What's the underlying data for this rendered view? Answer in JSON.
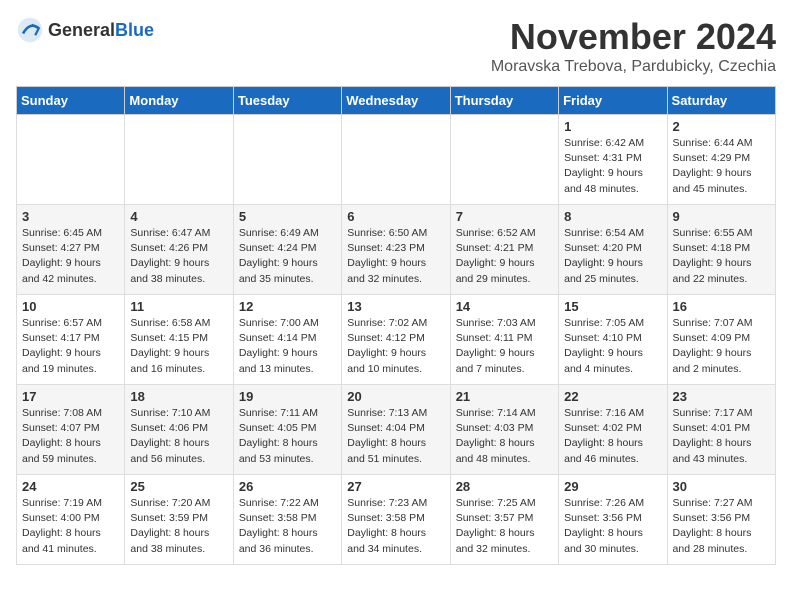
{
  "header": {
    "logo_general": "General",
    "logo_blue": "Blue",
    "month": "November 2024",
    "location": "Moravska Trebova, Pardubicky, Czechia"
  },
  "days_of_week": [
    "Sunday",
    "Monday",
    "Tuesday",
    "Wednesday",
    "Thursday",
    "Friday",
    "Saturday"
  ],
  "weeks": [
    [
      {
        "num": "",
        "info": ""
      },
      {
        "num": "",
        "info": ""
      },
      {
        "num": "",
        "info": ""
      },
      {
        "num": "",
        "info": ""
      },
      {
        "num": "",
        "info": ""
      },
      {
        "num": "1",
        "info": "Sunrise: 6:42 AM\nSunset: 4:31 PM\nDaylight: 9 hours and 48 minutes."
      },
      {
        "num": "2",
        "info": "Sunrise: 6:44 AM\nSunset: 4:29 PM\nDaylight: 9 hours and 45 minutes."
      }
    ],
    [
      {
        "num": "3",
        "info": "Sunrise: 6:45 AM\nSunset: 4:27 PM\nDaylight: 9 hours and 42 minutes."
      },
      {
        "num": "4",
        "info": "Sunrise: 6:47 AM\nSunset: 4:26 PM\nDaylight: 9 hours and 38 minutes."
      },
      {
        "num": "5",
        "info": "Sunrise: 6:49 AM\nSunset: 4:24 PM\nDaylight: 9 hours and 35 minutes."
      },
      {
        "num": "6",
        "info": "Sunrise: 6:50 AM\nSunset: 4:23 PM\nDaylight: 9 hours and 32 minutes."
      },
      {
        "num": "7",
        "info": "Sunrise: 6:52 AM\nSunset: 4:21 PM\nDaylight: 9 hours and 29 minutes."
      },
      {
        "num": "8",
        "info": "Sunrise: 6:54 AM\nSunset: 4:20 PM\nDaylight: 9 hours and 25 minutes."
      },
      {
        "num": "9",
        "info": "Sunrise: 6:55 AM\nSunset: 4:18 PM\nDaylight: 9 hours and 22 minutes."
      }
    ],
    [
      {
        "num": "10",
        "info": "Sunrise: 6:57 AM\nSunset: 4:17 PM\nDaylight: 9 hours and 19 minutes."
      },
      {
        "num": "11",
        "info": "Sunrise: 6:58 AM\nSunset: 4:15 PM\nDaylight: 9 hours and 16 minutes."
      },
      {
        "num": "12",
        "info": "Sunrise: 7:00 AM\nSunset: 4:14 PM\nDaylight: 9 hours and 13 minutes."
      },
      {
        "num": "13",
        "info": "Sunrise: 7:02 AM\nSunset: 4:12 PM\nDaylight: 9 hours and 10 minutes."
      },
      {
        "num": "14",
        "info": "Sunrise: 7:03 AM\nSunset: 4:11 PM\nDaylight: 9 hours and 7 minutes."
      },
      {
        "num": "15",
        "info": "Sunrise: 7:05 AM\nSunset: 4:10 PM\nDaylight: 9 hours and 4 minutes."
      },
      {
        "num": "16",
        "info": "Sunrise: 7:07 AM\nSunset: 4:09 PM\nDaylight: 9 hours and 2 minutes."
      }
    ],
    [
      {
        "num": "17",
        "info": "Sunrise: 7:08 AM\nSunset: 4:07 PM\nDaylight: 8 hours and 59 minutes."
      },
      {
        "num": "18",
        "info": "Sunrise: 7:10 AM\nSunset: 4:06 PM\nDaylight: 8 hours and 56 minutes."
      },
      {
        "num": "19",
        "info": "Sunrise: 7:11 AM\nSunset: 4:05 PM\nDaylight: 8 hours and 53 minutes."
      },
      {
        "num": "20",
        "info": "Sunrise: 7:13 AM\nSunset: 4:04 PM\nDaylight: 8 hours and 51 minutes."
      },
      {
        "num": "21",
        "info": "Sunrise: 7:14 AM\nSunset: 4:03 PM\nDaylight: 8 hours and 48 minutes."
      },
      {
        "num": "22",
        "info": "Sunrise: 7:16 AM\nSunset: 4:02 PM\nDaylight: 8 hours and 46 minutes."
      },
      {
        "num": "23",
        "info": "Sunrise: 7:17 AM\nSunset: 4:01 PM\nDaylight: 8 hours and 43 minutes."
      }
    ],
    [
      {
        "num": "24",
        "info": "Sunrise: 7:19 AM\nSunset: 4:00 PM\nDaylight: 8 hours and 41 minutes."
      },
      {
        "num": "25",
        "info": "Sunrise: 7:20 AM\nSunset: 3:59 PM\nDaylight: 8 hours and 38 minutes."
      },
      {
        "num": "26",
        "info": "Sunrise: 7:22 AM\nSunset: 3:58 PM\nDaylight: 8 hours and 36 minutes."
      },
      {
        "num": "27",
        "info": "Sunrise: 7:23 AM\nSunset: 3:58 PM\nDaylight: 8 hours and 34 minutes."
      },
      {
        "num": "28",
        "info": "Sunrise: 7:25 AM\nSunset: 3:57 PM\nDaylight: 8 hours and 32 minutes."
      },
      {
        "num": "29",
        "info": "Sunrise: 7:26 AM\nSunset: 3:56 PM\nDaylight: 8 hours and 30 minutes."
      },
      {
        "num": "30",
        "info": "Sunrise: 7:27 AM\nSunset: 3:56 PM\nDaylight: 8 hours and 28 minutes."
      }
    ]
  ]
}
